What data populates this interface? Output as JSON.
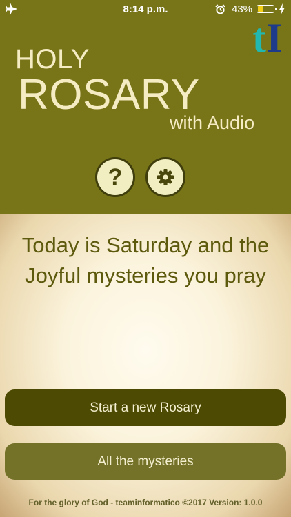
{
  "status_bar": {
    "time": "8:14 p.m.",
    "battery_percent": "43%",
    "battery_level": 0.43,
    "icons": [
      "airplane-icon",
      "alarm-icon",
      "battery-icon",
      "charging-bolt-icon"
    ]
  },
  "header": {
    "title_line1": "HOLY",
    "title_line2": "ROSARY",
    "subtitle": "with Audio",
    "logo_t": "t",
    "logo_i": "I",
    "help_label": "?",
    "help_icon": "question-mark-icon",
    "settings_icon": "gear-icon",
    "background_color": "#787519"
  },
  "main": {
    "message": "Today is Saturday and the Joyful mysteries you pray",
    "start_button_label": "Start a new Rosary",
    "mysteries_button_label": "All the mysteries",
    "footer": "For the glory of God - teaminformatico ©2017 Version: 1.0.0"
  }
}
